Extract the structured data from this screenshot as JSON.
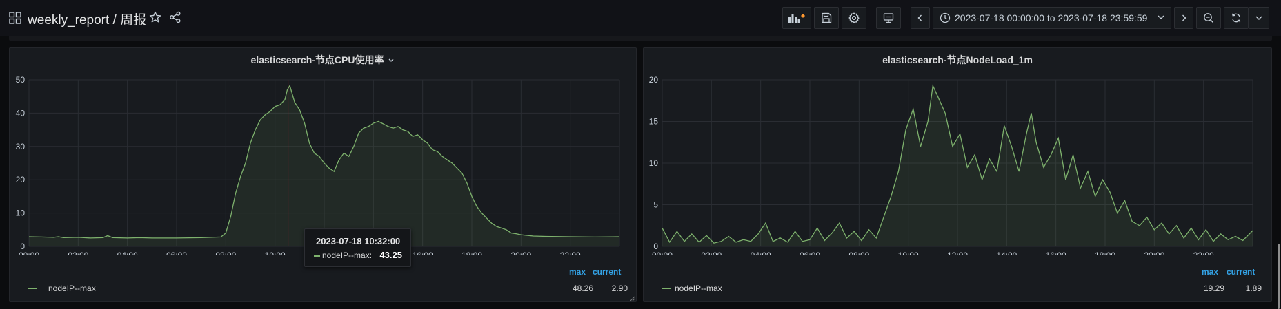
{
  "header": {
    "title": "weekly_report / 周报",
    "time_range": "2023-07-18 00:00:00 to 2023-07-18 23:59:59"
  },
  "colors": {
    "background": "#0b0c0e",
    "panel": "#181b1f",
    "series_green": "#7eb26d",
    "legend_head_blue": "#33a2e5",
    "crosshair_red": "#c4162a"
  },
  "icons": {
    "toolbar": [
      "add-panel-icon",
      "save-icon",
      "gear-icon",
      "monitor-icon",
      "chevron-left-icon",
      "clock-icon",
      "chevron-down-icon",
      "chevron-right-icon",
      "zoom-out-icon",
      "refresh-icon",
      "chevron-down-icon"
    ],
    "header": [
      "grid-icon",
      "star-icon",
      "share-icon"
    ]
  },
  "panels": [
    {
      "title": "elasticsearch-节点CPU使用率",
      "legend": {
        "headers": [
          "max",
          "current"
        ],
        "series": [
          {
            "name": "nodeIP--max",
            "max": "48.26",
            "current": "2.90"
          }
        ]
      },
      "tooltip": {
        "time": "2023-07-18 10:32:00",
        "series": "nodeIP--max:",
        "value": "43.25"
      }
    },
    {
      "title": "elasticsearch-节点NodeLoad_1m",
      "legend": {
        "headers": [
          "max",
          "current"
        ],
        "series": [
          {
            "name": "nodeIP--max",
            "max": "19.29",
            "current": "1.89"
          }
        ]
      }
    }
  ],
  "chart_data": [
    {
      "type": "area",
      "title": "elasticsearch-节点CPU使用率",
      "x_unit": "hour",
      "x_ticks": [
        "00:00",
        "02:00",
        "04:00",
        "06:00",
        "08:00",
        "10:00",
        "12:00",
        "14:00",
        "16:00",
        "18:00",
        "20:00",
        "22:00"
      ],
      "y_ticks": [
        "0",
        "10",
        "20",
        "30",
        "40",
        "50"
      ],
      "xlim": [
        0,
        24
      ],
      "ylim": [
        0,
        50
      ],
      "grid": true,
      "legend_position": "bottom",
      "crosshair_x": 10.53,
      "series": [
        {
          "name": "nodeIP--max",
          "x": [
            0,
            0.5,
            1,
            1.2,
            1.4,
            2,
            2.5,
            3,
            3.2,
            3.4,
            4,
            4.5,
            5,
            6,
            7,
            7.8,
            8,
            8.2,
            8.4,
            8.6,
            8.8,
            9,
            9.2,
            9.4,
            9.6,
            9.8,
            10,
            10.2,
            10.4,
            10.5,
            10.6,
            10.8,
            11,
            11.2,
            11.4,
            11.6,
            11.8,
            12,
            12.2,
            12.4,
            12.6,
            12.8,
            13,
            13.2,
            13.4,
            13.6,
            13.8,
            14,
            14.2,
            14.4,
            14.6,
            14.8,
            15,
            15.2,
            15.4,
            15.6,
            15.8,
            16,
            16.2,
            16.4,
            16.6,
            16.8,
            17,
            17.2,
            17.4,
            17.6,
            17.8,
            18,
            18.2,
            18.4,
            18.6,
            18.8,
            19,
            19.2,
            19.4,
            19.6,
            19.8,
            20,
            20.5,
            21,
            22,
            23,
            24
          ],
          "y": [
            2.9,
            2.8,
            2.7,
            2.9,
            2.6,
            2.7,
            2.5,
            2.6,
            3.2,
            2.6,
            2.5,
            2.6,
            2.5,
            2.5,
            2.6,
            2.8,
            4,
            9,
            16,
            21,
            25,
            31,
            35,
            38,
            39.5,
            40.5,
            42,
            42.5,
            44,
            47,
            48.26,
            43.25,
            41,
            37,
            31,
            28,
            27,
            25,
            23.5,
            22.5,
            26,
            28,
            27,
            30,
            34,
            35.5,
            36,
            37,
            37.5,
            36.8,
            36,
            35.5,
            36,
            35,
            34.5,
            33,
            33.5,
            32,
            31,
            29,
            28.5,
            27,
            26,
            25,
            23.5,
            22,
            19,
            15,
            12,
            10,
            8.5,
            7,
            6,
            5.5,
            5,
            4,
            3.8,
            3.5,
            3.1,
            3.0,
            2.9,
            2.8,
            2.9
          ]
        }
      ]
    },
    {
      "type": "area",
      "title": "elasticsearch-节点NodeLoad_1m",
      "x_unit": "hour",
      "x_ticks": [
        "00:00",
        "02:00",
        "04:00",
        "06:00",
        "08:00",
        "10:00",
        "12:00",
        "14:00",
        "16:00",
        "18:00",
        "20:00",
        "22:00"
      ],
      "y_ticks": [
        "0",
        "5",
        "10",
        "15",
        "20"
      ],
      "xlim": [
        0,
        24
      ],
      "ylim": [
        0,
        20
      ],
      "grid": true,
      "legend_position": "bottom",
      "series": [
        {
          "name": "nodeIP--max",
          "x": [
            0,
            0.3,
            0.6,
            0.9,
            1.2,
            1.5,
            1.8,
            2.1,
            2.4,
            2.7,
            3.0,
            3.3,
            3.6,
            3.9,
            4.2,
            4.5,
            4.8,
            5.1,
            5.4,
            5.7,
            6.0,
            6.3,
            6.6,
            6.9,
            7.2,
            7.5,
            7.8,
            8.1,
            8.4,
            8.7,
            9.0,
            9.3,
            9.6,
            9.9,
            10.2,
            10.5,
            10.8,
            11.0,
            11.2,
            11.5,
            11.8,
            12.1,
            12.4,
            12.7,
            13.0,
            13.3,
            13.6,
            13.9,
            14.2,
            14.5,
            14.8,
            15.0,
            15.2,
            15.5,
            15.8,
            16.1,
            16.4,
            16.7,
            17.0,
            17.3,
            17.6,
            17.9,
            18.2,
            18.5,
            18.8,
            19.1,
            19.4,
            19.7,
            20.0,
            20.3,
            20.6,
            20.9,
            21.2,
            21.5,
            21.8,
            22.1,
            22.4,
            22.7,
            23.0,
            23.3,
            23.6,
            24.0
          ],
          "y": [
            2.2,
            0.5,
            1.8,
            0.6,
            1.5,
            0.5,
            1.3,
            0.4,
            0.6,
            1.2,
            0.5,
            0.8,
            0.6,
            1.5,
            2.8,
            0.6,
            1.0,
            0.5,
            1.8,
            0.6,
            0.8,
            2.2,
            0.7,
            1.6,
            2.8,
            1.0,
            1.8,
            0.7,
            2.0,
            1.0,
            3.5,
            6.0,
            9.0,
            14.0,
            16.5,
            12.0,
            15.0,
            19.29,
            18.0,
            16.0,
            12.0,
            13.5,
            9.5,
            11.0,
            8.0,
            10.5,
            9.0,
            14.5,
            12.0,
            9.0,
            13.5,
            16.0,
            12.5,
            9.5,
            11.0,
            13.0,
            8.0,
            11.0,
            7.0,
            9.0,
            6.0,
            8.0,
            6.5,
            4.0,
            5.5,
            3.0,
            2.5,
            3.5,
            2.0,
            2.8,
            1.5,
            2.5,
            1.0,
            2.2,
            0.8,
            2.0,
            0.6,
            1.5,
            0.8,
            1.2,
            0.7,
            1.89
          ]
        }
      ]
    }
  ]
}
